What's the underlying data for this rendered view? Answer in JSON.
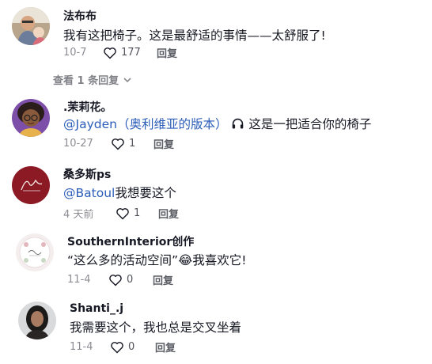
{
  "comments": [
    {
      "username": "法布布",
      "text": "我有这把椅子。这是最舒适的事情——太舒服了!",
      "date": "10-7",
      "likes": "177",
      "reply": "回复",
      "avatar": "photo-avatar"
    },
    {
      "username": ".茉莉花。",
      "mention": "@Jayden（奥利维亚的版本）",
      "icon": "headphones-icon",
      "text": "这是一把适合你的椅子",
      "date": "10-27",
      "likes": "1",
      "reply": "回复",
      "avatar": "cartoon-avatar"
    },
    {
      "username": "桑多斯ps",
      "mention": "@Batoul",
      "text": "我想要这个",
      "date": "4 天前",
      "likes": "1",
      "reply": "回复",
      "avatar": "logo-avatar",
      "avatar_color": "#8b1a24"
    },
    {
      "username": "SouthernInterior创作",
      "text": "“这么多的活动空间”",
      "emoji": "😂",
      "text2": "我喜欢它!",
      "date": "11-4",
      "likes": "0",
      "reply": "回复",
      "avatar": "floral-logo-avatar"
    },
    {
      "username": "Shanti_.j",
      "text": "我需要这个，我也总是交叉坐着",
      "date": "11-4",
      "likes": "0",
      "reply": "回复",
      "avatar": "photo-avatar"
    }
  ],
  "view_replies": "查看 1 条回复",
  "colors": {
    "mention": "#2b5db9",
    "text": "#161823",
    "meta": "#8a8b91"
  }
}
